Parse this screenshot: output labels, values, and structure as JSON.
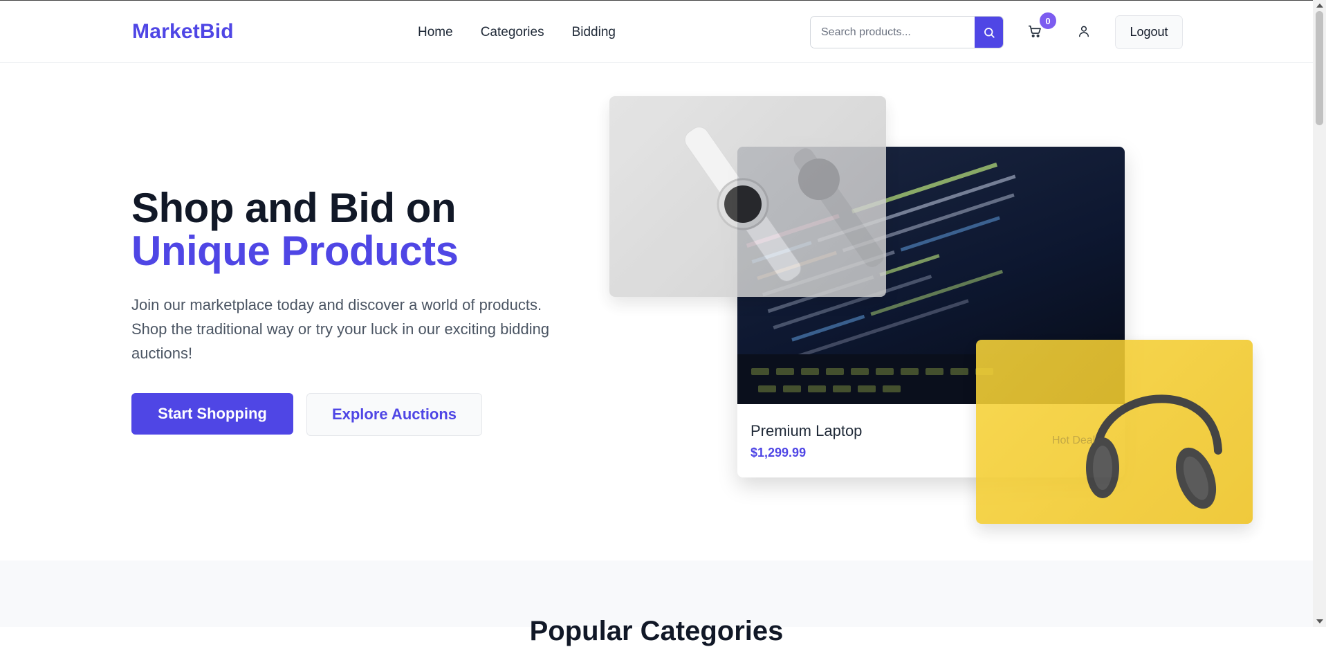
{
  "header": {
    "logo": "MarketBid",
    "nav": [
      "Home",
      "Categories",
      "Bidding"
    ],
    "search_placeholder": "Search products...",
    "cart_count": "0",
    "logout_label": "Logout",
    "icons": {
      "search": "search-icon",
      "cart": "cart-icon",
      "user": "user-icon"
    }
  },
  "hero": {
    "title_line1": "Shop and Bid on",
    "title_line2": "Unique Products",
    "description": "Join our marketplace today and discover a world of products. Shop the traditional way or try your luck in our exciting bidding auctions!",
    "primary_button": "Start Shopping",
    "secondary_button": "Explore Auctions"
  },
  "featured": {
    "product_title": "Premium Laptop",
    "product_price": "$1,299.99",
    "hot_deal": "Hot Deal"
  },
  "section": {
    "heading": "Popular Categories"
  },
  "colors": {
    "accent": "#4f46e5",
    "badge": "#7c5cf0",
    "text": "#111827"
  }
}
